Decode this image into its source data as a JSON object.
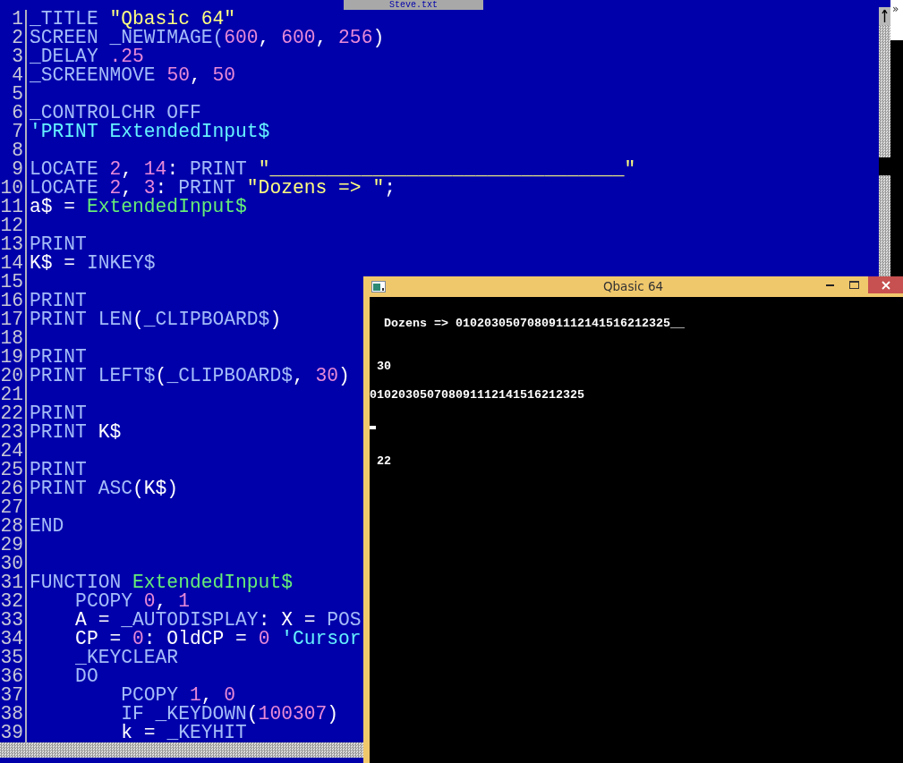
{
  "editor": {
    "title": "Steve.txt",
    "lines": [
      {
        "number": "1",
        "tokens": [
          {
            "kind": "keyword",
            "text": "_TITLE "
          },
          {
            "kind": "string",
            "text": "\"Qbasic 64\""
          }
        ]
      },
      {
        "number": "2",
        "tokens": [
          {
            "kind": "keyword",
            "text": "SCREEN _NEWIMAGE("
          },
          {
            "kind": "number",
            "text": "600"
          },
          {
            "kind": "plain",
            "text": ", "
          },
          {
            "kind": "number",
            "text": "600"
          },
          {
            "kind": "plain",
            "text": ", "
          },
          {
            "kind": "number",
            "text": "256"
          },
          {
            "kind": "plain",
            "text": ")"
          }
        ]
      },
      {
        "number": "3",
        "tokens": [
          {
            "kind": "keyword",
            "text": "_DELAY "
          },
          {
            "kind": "number",
            "text": ".25"
          }
        ]
      },
      {
        "number": "4",
        "tokens": [
          {
            "kind": "keyword",
            "text": "_SCREENMOVE "
          },
          {
            "kind": "number",
            "text": "50"
          },
          {
            "kind": "plain",
            "text": ", "
          },
          {
            "kind": "number",
            "text": "50"
          }
        ]
      },
      {
        "number": "5"
      },
      {
        "number": "6",
        "tokens": [
          {
            "kind": "keyword",
            "text": "_CONTROLCHR OFF"
          }
        ]
      },
      {
        "number": "7",
        "tokens": [
          {
            "kind": "comment",
            "text": "'PRINT ExtendedInput$"
          }
        ]
      },
      {
        "number": "8"
      },
      {
        "number": "9",
        "tokens": [
          {
            "kind": "keyword",
            "text": "LOCATE "
          },
          {
            "kind": "number",
            "text": "2"
          },
          {
            "kind": "plain",
            "text": ", "
          },
          {
            "kind": "number",
            "text": "14"
          },
          {
            "kind": "plain",
            "text": ": "
          },
          {
            "kind": "keyword",
            "text": "PRINT "
          },
          {
            "kind": "string",
            "text": "\"_______________________________\""
          }
        ]
      },
      {
        "number": "10",
        "tokens": [
          {
            "kind": "keyword",
            "text": "LOCATE "
          },
          {
            "kind": "number",
            "text": "2"
          },
          {
            "kind": "plain",
            "text": ", "
          },
          {
            "kind": "number",
            "text": "3"
          },
          {
            "kind": "plain",
            "text": ": "
          },
          {
            "kind": "keyword",
            "text": "PRINT "
          },
          {
            "kind": "string",
            "text": "\"Dozens => \""
          },
          {
            "kind": "plain",
            "text": ";"
          }
        ]
      },
      {
        "number": "11",
        "tokens": [
          {
            "kind": "plain",
            "text": "a$ = "
          },
          {
            "kind": "function",
            "text": "ExtendedInput$"
          }
        ]
      },
      {
        "number": "12"
      },
      {
        "number": "13",
        "tokens": [
          {
            "kind": "keyword",
            "text": "PRINT"
          }
        ]
      },
      {
        "number": "14",
        "tokens": [
          {
            "kind": "plain",
            "text": "K$ = "
          },
          {
            "kind": "keyword",
            "text": "INKEY$"
          }
        ]
      },
      {
        "number": "15"
      },
      {
        "number": "16",
        "tokens": [
          {
            "kind": "keyword",
            "text": "PRINT"
          }
        ]
      },
      {
        "number": "17",
        "tokens": [
          {
            "kind": "keyword",
            "text": "PRINT LEN"
          },
          {
            "kind": "plain",
            "text": "("
          },
          {
            "kind": "keyword",
            "text": "_CLIPBOARD$"
          },
          {
            "kind": "plain",
            "text": ")"
          }
        ]
      },
      {
        "number": "18"
      },
      {
        "number": "19",
        "tokens": [
          {
            "kind": "keyword",
            "text": "PRINT"
          }
        ]
      },
      {
        "number": "20",
        "tokens": [
          {
            "kind": "keyword",
            "text": "PRINT LEFT$"
          },
          {
            "kind": "plain",
            "text": "("
          },
          {
            "kind": "keyword",
            "text": "_CLIPBOARD$"
          },
          {
            "kind": "plain",
            "text": ", "
          },
          {
            "kind": "number",
            "text": "30"
          },
          {
            "kind": "plain",
            "text": ")"
          }
        ]
      },
      {
        "number": "21"
      },
      {
        "number": "22",
        "tokens": [
          {
            "kind": "keyword",
            "text": "PRINT"
          }
        ]
      },
      {
        "number": "23",
        "tokens": [
          {
            "kind": "keyword",
            "text": "PRINT "
          },
          {
            "kind": "plain",
            "text": "K$"
          }
        ]
      },
      {
        "number": "24"
      },
      {
        "number": "25",
        "tokens": [
          {
            "kind": "keyword",
            "text": "PRINT"
          }
        ]
      },
      {
        "number": "26",
        "tokens": [
          {
            "kind": "keyword",
            "text": "PRINT ASC"
          },
          {
            "kind": "plain",
            "text": "(K$)"
          }
        ]
      },
      {
        "number": "27"
      },
      {
        "number": "28",
        "tokens": [
          {
            "kind": "keyword",
            "text": "END"
          }
        ]
      },
      {
        "number": "29"
      },
      {
        "number": "30"
      },
      {
        "number": "31",
        "tokens": [
          {
            "kind": "keyword",
            "text": "FUNCTION "
          },
          {
            "kind": "function",
            "text": "ExtendedInput$"
          }
        ]
      },
      {
        "number": "32",
        "tokens": [
          {
            "kind": "keyword",
            "text": "    PCOPY "
          },
          {
            "kind": "number",
            "text": "0"
          },
          {
            "kind": "plain",
            "text": ", "
          },
          {
            "kind": "number",
            "text": "1"
          }
        ]
      },
      {
        "number": "33",
        "tokens": [
          {
            "kind": "plain",
            "text": "    A = "
          },
          {
            "kind": "keyword",
            "text": "_AUTODISPLAY"
          },
          {
            "kind": "plain",
            "text": ": X = "
          },
          {
            "kind": "keyword",
            "text": "POS"
          }
        ]
      },
      {
        "number": "34",
        "tokens": [
          {
            "kind": "plain",
            "text": "    CP = "
          },
          {
            "kind": "number",
            "text": "0"
          },
          {
            "kind": "plain",
            "text": ": OldCP = "
          },
          {
            "kind": "number",
            "text": "0"
          },
          {
            "kind": "comment",
            "text": " 'Cursor"
          }
        ]
      },
      {
        "number": "35",
        "tokens": [
          {
            "kind": "keyword",
            "text": "    _KEYCLEAR"
          }
        ]
      },
      {
        "number": "36",
        "tokens": [
          {
            "kind": "keyword",
            "text": "    DO"
          }
        ]
      },
      {
        "number": "37",
        "tokens": [
          {
            "kind": "keyword",
            "text": "        PCOPY "
          },
          {
            "kind": "number",
            "text": "1"
          },
          {
            "kind": "plain",
            "text": ", "
          },
          {
            "kind": "number",
            "text": "0"
          }
        ]
      },
      {
        "number": "38",
        "tokens": [
          {
            "kind": "keyword",
            "text": "        IF _KEYDOWN"
          },
          {
            "kind": "plain",
            "text": "("
          },
          {
            "kind": "number",
            "text": "100307"
          },
          {
            "kind": "plain",
            "text": ")"
          }
        ]
      },
      {
        "number": "39",
        "tokens": [
          {
            "kind": "plain",
            "text": "        k = "
          },
          {
            "kind": "keyword",
            "text": "_KEYHIT"
          }
        ]
      }
    ]
  },
  "side_panel": {
    "glyph": "»"
  },
  "console": {
    "title": "Qbasic 64",
    "rows": [
      {
        "kind": "text",
        "text": "  Dozens => 010203050708091112141516212325__"
      },
      {
        "kind": "blank"
      },
      {
        "kind": "blank"
      },
      {
        "kind": "text",
        "text": " 30"
      },
      {
        "kind": "blank"
      },
      {
        "kind": "text",
        "text": "010203050708091112141516212325"
      },
      {
        "kind": "blank"
      },
      {
        "kind": "cursor"
      },
      {
        "kind": "blank"
      },
      {
        "kind": "text",
        "text": " 22"
      }
    ]
  }
}
